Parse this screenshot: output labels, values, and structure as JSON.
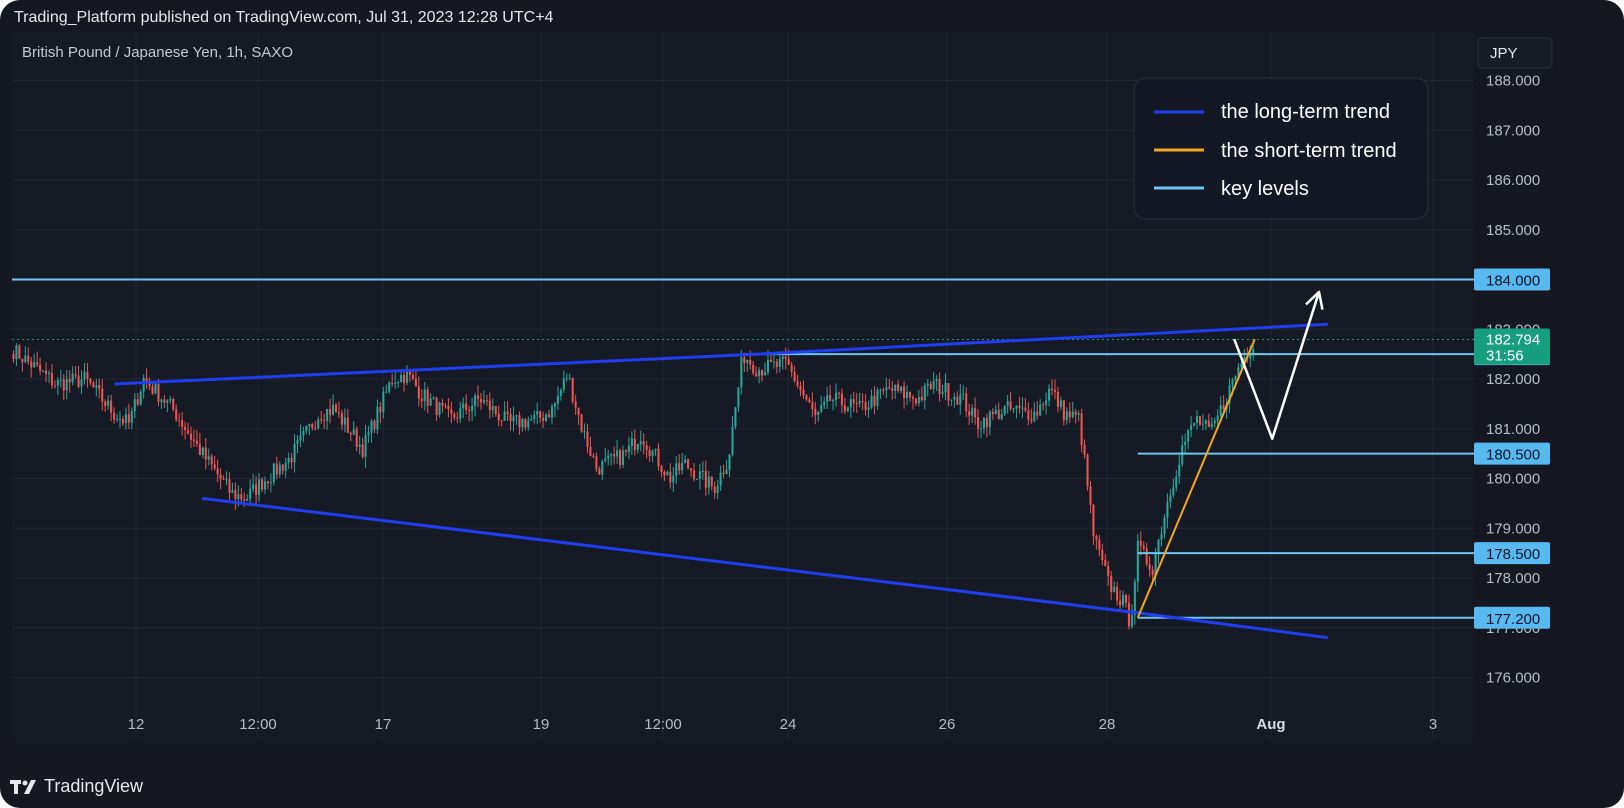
{
  "header": {
    "published_line": "Trading_Platform published on TradingView.com, Jul 31, 2023 12:28 UTC+4"
  },
  "footer": {
    "brand": "TradingView",
    "logo_icon": "tradingview-logo-icon"
  },
  "colors": {
    "background": "#151821",
    "chart_bg": "#161a25",
    "grid": "#232735",
    "bull": "#26a69a",
    "bear": "#ef5350",
    "long_trend": "#1f3ff0",
    "short_trend": "#f5a623",
    "key_level": "#6ec6f5",
    "badge": "#58b8f0",
    "last_price_badge": "#169e7f"
  },
  "chart_data": {
    "type": "candlestick",
    "symbol_title": "British Pound / Japanese Yen, 1h, SAXO",
    "currency": "JPY",
    "y_ticks": [
      "176.000",
      "177.000",
      "178.000",
      "179.000",
      "180.000",
      "181.000",
      "182.000",
      "183.000",
      "184.000",
      "185.000",
      "186.000",
      "187.000",
      "188.000"
    ],
    "ylim": [
      175.1,
      188.6
    ],
    "x_ticks": [
      {
        "label": "12",
        "bold": false
      },
      {
        "label": "12:00",
        "bold": false
      },
      {
        "label": "17",
        "bold": false
      },
      {
        "label": "19",
        "bold": false
      },
      {
        "label": "12:00",
        "bold": false
      },
      {
        "label": "24",
        "bold": false
      },
      {
        "label": "26",
        "bold": false
      },
      {
        "label": "28",
        "bold": false
      },
      {
        "label": "Aug",
        "bold": true
      },
      {
        "label": "3",
        "bold": false
      }
    ],
    "price_path": [
      [
        0,
        182.6
      ],
      [
        0.03,
        181.9
      ],
      [
        0.05,
        182.0
      ],
      [
        0.07,
        181.3
      ],
      [
        0.08,
        181.1
      ],
      [
        0.09,
        182.0
      ],
      [
        0.11,
        181.4
      ],
      [
        0.13,
        180.5
      ],
      [
        0.15,
        179.7
      ],
      [
        0.16,
        179.6
      ],
      [
        0.17,
        179.9
      ],
      [
        0.19,
        180.4
      ],
      [
        0.21,
        181.3
      ],
      [
        0.22,
        181.4
      ],
      [
        0.24,
        180.6
      ],
      [
        0.26,
        182.0
      ],
      [
        0.27,
        182.1
      ],
      [
        0.28,
        181.7
      ],
      [
        0.3,
        181.2
      ],
      [
        0.32,
        181.6
      ],
      [
        0.34,
        181.1
      ],
      [
        0.36,
        181.2
      ],
      [
        0.37,
        181.4
      ],
      [
        0.38,
        182.1
      ],
      [
        0.39,
        181.0
      ],
      [
        0.4,
        180.2
      ],
      [
        0.42,
        180.5
      ],
      [
        0.43,
        180.9
      ],
      [
        0.45,
        180.0
      ],
      [
        0.46,
        180.3
      ],
      [
        0.48,
        179.8
      ],
      [
        0.49,
        180.4
      ],
      [
        0.5,
        182.5
      ],
      [
        0.51,
        182.2
      ],
      [
        0.53,
        182.3
      ],
      [
        0.55,
        181.2
      ],
      [
        0.56,
        181.6
      ],
      [
        0.58,
        181.4
      ],
      [
        0.6,
        181.8
      ],
      [
        0.62,
        181.6
      ],
      [
        0.63,
        181.9
      ],
      [
        0.65,
        181.6
      ],
      [
        0.66,
        181.1
      ],
      [
        0.68,
        181.4
      ],
      [
        0.7,
        181.3
      ],
      [
        0.71,
        181.8
      ],
      [
        0.72,
        181.3
      ],
      [
        0.73,
        181.2
      ],
      [
        0.74,
        178.8
      ],
      [
        0.75,
        177.9
      ],
      [
        0.76,
        177.5
      ],
      [
        0.765,
        177.1
      ],
      [
        0.77,
        178.6
      ],
      [
        0.78,
        178.2
      ],
      [
        0.79,
        179.5
      ],
      [
        0.8,
        180.6
      ],
      [
        0.81,
        181.2
      ],
      [
        0.82,
        180.9
      ],
      [
        0.83,
        181.6
      ],
      [
        0.84,
        182.3
      ],
      [
        0.85,
        182.8
      ]
    ],
    "key_levels": [
      {
        "value": 184.0,
        "label": "184.000",
        "from": "start"
      },
      {
        "value": 182.5,
        "label": "182.500",
        "from": "jul-24-high"
      },
      {
        "value": 180.5,
        "label": "180.500",
        "from": "jul-28"
      },
      {
        "value": 178.5,
        "label": "178.500",
        "from": "jul-28"
      },
      {
        "value": 177.2,
        "label": "177.200",
        "from": "jul-28"
      }
    ],
    "last_price": {
      "value": 182.794,
      "label": "182.794",
      "countdown": "31:56"
    },
    "trend_lines": [
      {
        "name": "the long-term trend",
        "kind": "upper",
        "points": [
          [
            0.07,
            181.9
          ],
          [
            0.51,
            182.5
          ],
          [
            0.9,
            183.1
          ]
        ]
      },
      {
        "name": "the long-term trend",
        "kind": "lower",
        "points": [
          [
            0.13,
            179.6
          ],
          [
            0.77,
            177.3
          ],
          [
            0.9,
            176.8
          ]
        ]
      },
      {
        "name": "the short-term trend",
        "kind": "short",
        "points": [
          [
            0.77,
            177.2
          ],
          [
            0.85,
            182.8
          ]
        ]
      }
    ],
    "projection_path": [
      [
        0.836,
        182.8
      ],
      [
        0.862,
        180.8
      ],
      [
        0.894,
        183.75
      ]
    ],
    "legend": {
      "placement": "top-right",
      "items": [
        {
          "label": "the long-term trend",
          "color": "#1f3ff0"
        },
        {
          "label": "the short-term trend",
          "color": "#f5a623"
        },
        {
          "label": "key levels",
          "color": "#6ec6f5"
        }
      ]
    },
    "grid": true
  }
}
